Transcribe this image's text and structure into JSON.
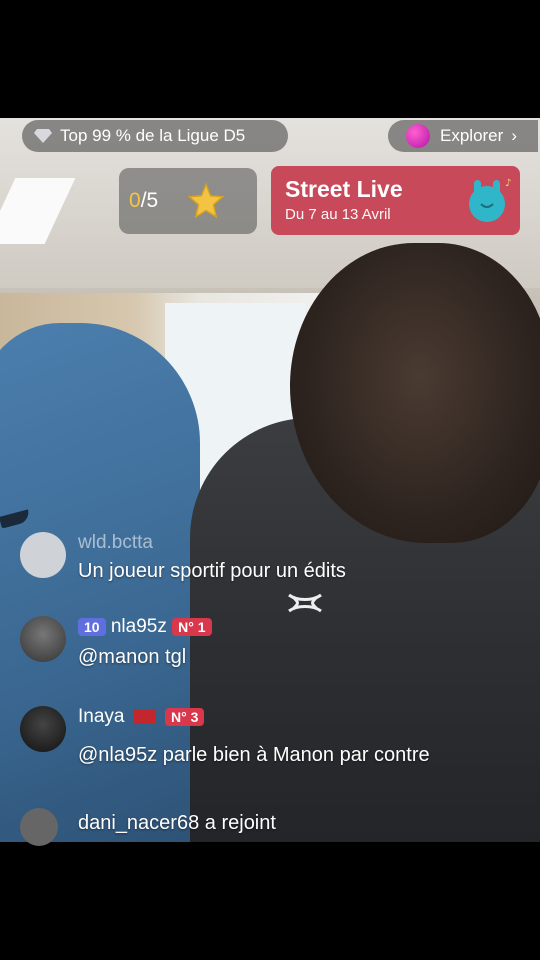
{
  "top_bar": {
    "league_text": "Top 99 % de la Ligue D5",
    "explore_label": "Explorer",
    "explore_chevron": "›"
  },
  "score": {
    "current": "0",
    "total": "/5",
    "icon": "star-icon"
  },
  "banner": {
    "title": "Street Live",
    "dates": "Du 7 au 13 Avril",
    "icon": "rock-hand-icon",
    "color": "#c8495a"
  },
  "comments": [
    {
      "user": "wld.bctta",
      "text": "Un joueur sportif pour un édits"
    },
    {
      "user": "nla95z",
      "level": "10",
      "rank": "N° 1",
      "text": "@manon tgl"
    },
    {
      "user": "Inaya",
      "rank": "N° 3",
      "text": "@nla95z parle bien à Manon par contre"
    },
    {
      "user": "dani_nacer68",
      "text": "a rejoint"
    }
  ],
  "video": {
    "logo_caption": "UNDER ARMOUR"
  }
}
